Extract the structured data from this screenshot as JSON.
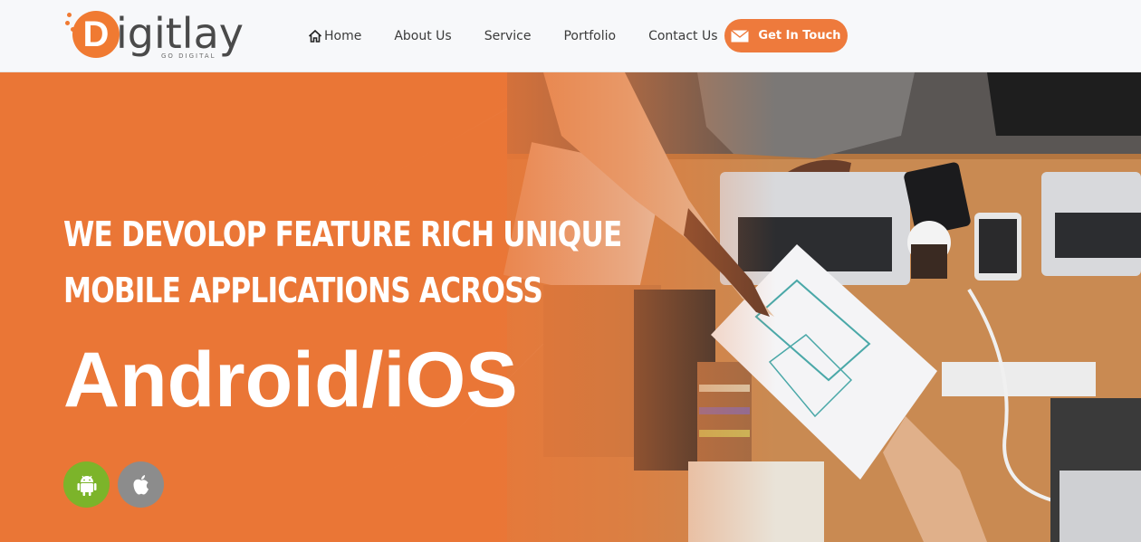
{
  "brand": {
    "name_first": "D",
    "name_rest_before_o": "igit",
    "name_rest": "lay",
    "tagline": "GO DIGITAL",
    "accent_color": "#f07a32"
  },
  "nav": {
    "items": [
      {
        "label": "Home",
        "icon": "home-icon"
      },
      {
        "label": "About Us"
      },
      {
        "label": "Service"
      },
      {
        "label": "Portfolio"
      },
      {
        "label": "Contact Us"
      }
    ],
    "cta": {
      "label": "Get In Touch",
      "icon": "mail-icon",
      "color": "#ee7a3c"
    }
  },
  "hero": {
    "headline_line1": "WE DEVOLOP FEATURE RICH UNIQUE",
    "headline_line2": "MOBILE APPLICATIONS ACROSS",
    "platforms": "Android/iOS",
    "overlay_color": "#ea7636",
    "badges": [
      {
        "name": "android",
        "icon": "android-icon",
        "color": "#7cb42a"
      },
      {
        "name": "apple",
        "icon": "apple-icon",
        "color": "#8c8c8c"
      }
    ]
  }
}
